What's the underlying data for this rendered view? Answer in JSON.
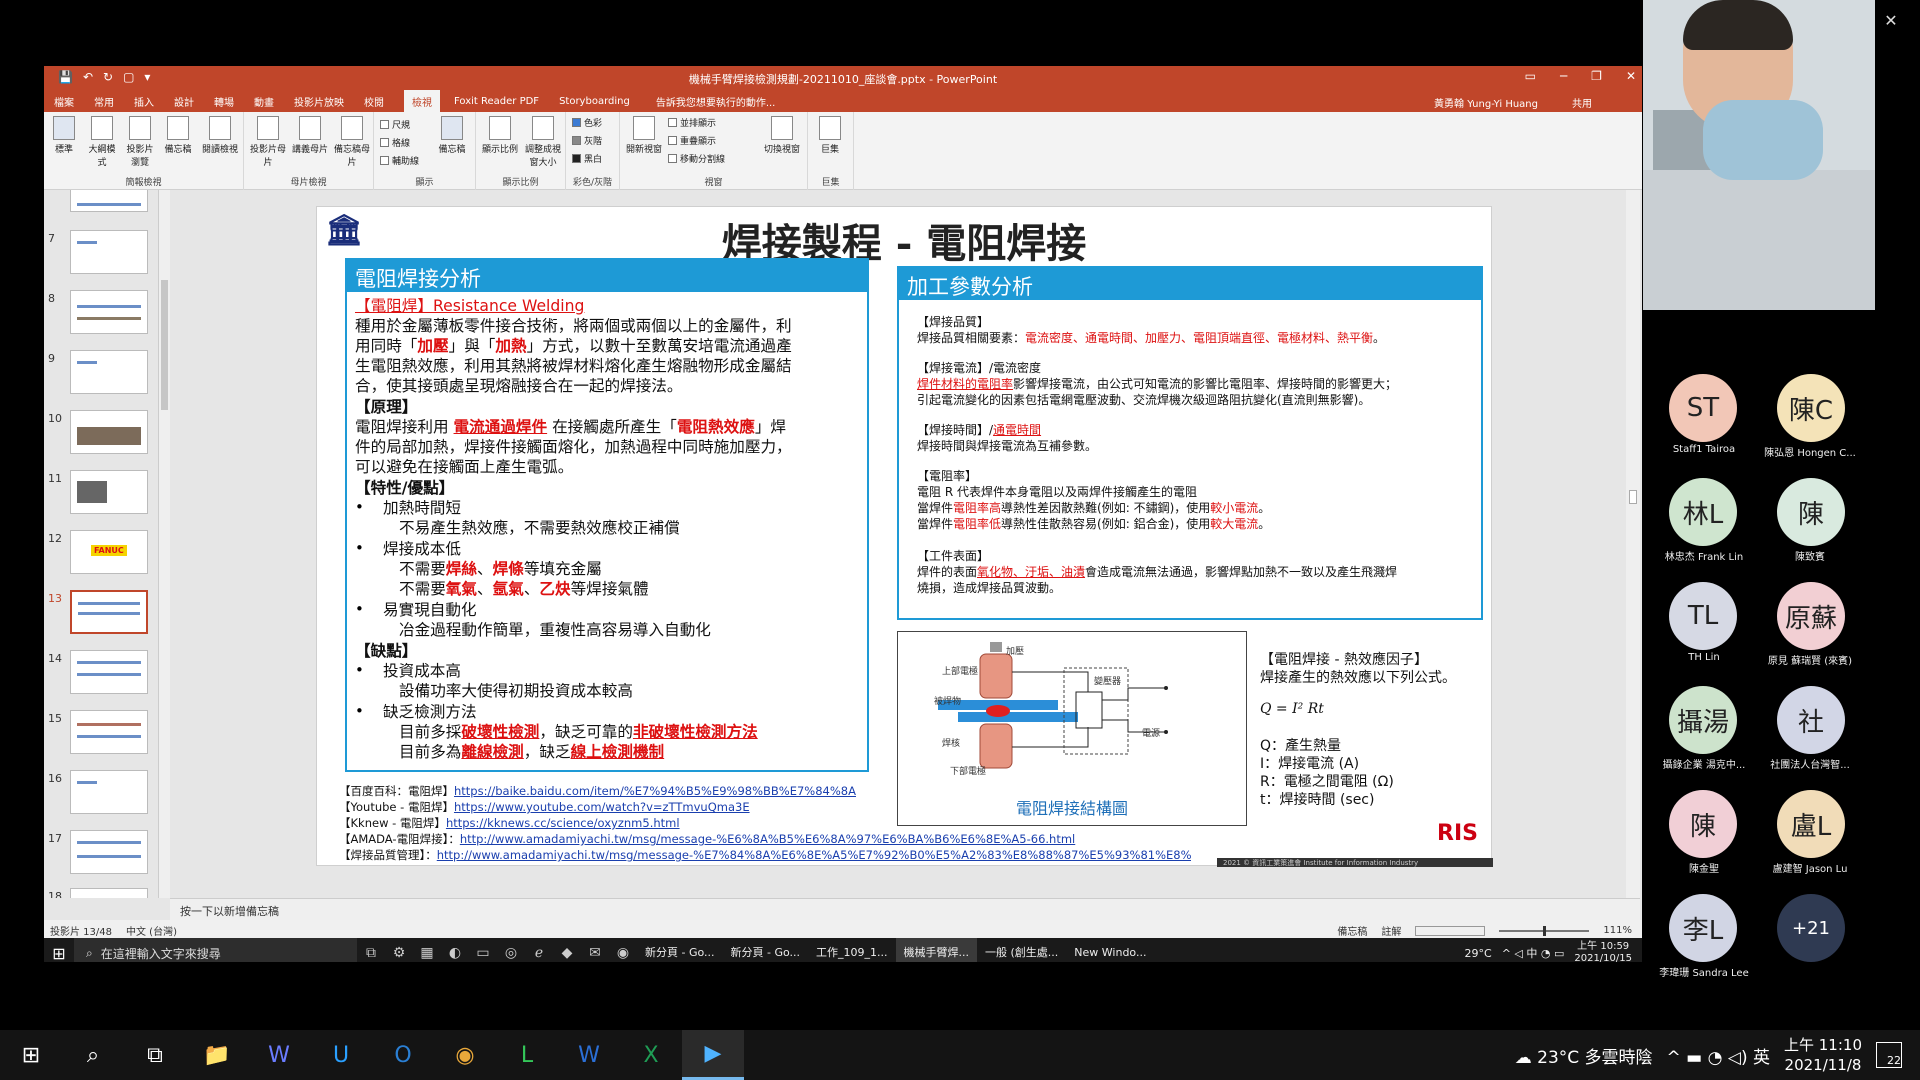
{
  "window": {
    "minimize": "─",
    "restore": "❐",
    "close": "✕"
  },
  "ppt": {
    "title": "機械手臂焊接檢測規劃-20211010_座談會.pptx - PowerPoint",
    "qa": [
      "💾",
      "↶",
      "↻",
      "▢",
      "▾"
    ],
    "win_btns": [
      "▭",
      "─",
      "❐",
      "✕"
    ],
    "tabs": [
      "檔案",
      "常用",
      "插入",
      "設計",
      "轉場",
      "動畫",
      "投影片放映",
      "校閱",
      "檢視",
      "Foxit Reader PDF",
      "Storyboarding"
    ],
    "active_tab": "檢視",
    "tell_me": "告訴我您想要執行的動作...",
    "user": "黃勇翰 Yung-Yi Huang",
    "share": "共用",
    "ribbon": {
      "g1_buttons": [
        "標準",
        "大綱模式",
        "投影片瀏覽",
        "備忘稿",
        "閱讀檢視"
      ],
      "g1_label": "簡報檢視",
      "g2_buttons": [
        "投影片母片",
        "講義母片",
        "備忘稿母片"
      ],
      "g2_label": "母片檢視",
      "g3_checks": [
        "尺規",
        "格線",
        "輔助線"
      ],
      "g3_btn": "備忘稿",
      "g3_label": "顯示",
      "g4_buttons": [
        "顯示比例",
        "調整成視窗大小"
      ],
      "g4_label": "顯示比例",
      "g5_items": [
        "色彩",
        "灰階",
        "黑白"
      ],
      "g5_label": "彩色/灰階",
      "g6_btn": "開新視窗",
      "g6_items": [
        "並排顯示",
        "重疊顯示",
        "移動分割線"
      ],
      "g6_btn2": "切換視窗",
      "g6_label": "視窗",
      "g7_btn": "巨集",
      "g7_label": "巨集"
    },
    "thumb_numbers": [
      "7",
      "8",
      "9",
      "10",
      "11",
      "12",
      "13",
      "14",
      "15",
      "16",
      "17",
      "18"
    ],
    "thumb_fanuc": "FANUC",
    "notes_placeholder": "按一下以新增備忘稿",
    "status": {
      "slide": "投影片 13/48",
      "lang": "中文 (台灣)",
      "notes": "備忘稿",
      "comments": "註解",
      "zoom": "111%"
    }
  },
  "slide": {
    "logo": "🏛",
    "title": "焊接製程 - 電阻焊接",
    "left_header": "電阻焊接分析",
    "l1a": "【電阻焊】Resistance Welding",
    "l2": "種用於金屬薄板零件接合技術，將兩個或兩個以上的金屬件，利",
    "l3a": "用同時「",
    "l3b": "加壓",
    "l3c": "」與「",
    "l3d": "加熱",
    "l3e": "」方式，以數十至數萬安培電流通過產",
    "l4": "生電阻熱效應，利用其熱將被焊材料熔化產生熔融物形成金屬結",
    "l5": "合，使其接頭處呈現熔融接合在一起的焊接法。",
    "l6": "【原理】",
    "l7a": "電阻焊接利用 ",
    "l7b": "電流通過焊件",
    "l7c": " 在接觸處所產生「",
    "l7d": "電阻熱效應",
    "l7e": "」焊",
    "l8": "件的局部加熱，焊接件接觸面熔化，加熱過程中同時施加壓力，",
    "l9": "可以避免在接觸面上產生電弧。",
    "l10": "【特性/優點】",
    "bullet": "•",
    "l11": "加熱時間短",
    "l12": "不易產生熱效應，不需要熱效應校正補償",
    "l13": "焊接成本低",
    "l14a": "不需要",
    "l14b": "焊絲",
    "l14c": "、",
    "l14d": "焊條",
    "l14e": "等填充金屬",
    "l15a": "不需要",
    "l15b": "氧氣",
    "l15c": "、",
    "l15d": "氬氣",
    "l15e": "、",
    "l15f": "乙炔",
    "l15g": "等焊接氣體",
    "l16": "易實現自動化",
    "l17": "冶金過程動作簡單，重複性高容易導入自動化",
    "l18": "【缺點】",
    "l19": "投資成本高",
    "l20": "設備功率大使得初期投資成本較高",
    "l21": "缺乏檢測方法",
    "l22a": "目前多採",
    "l22b": "破壞性檢測",
    "l22c": "，缺乏可靠的",
    "l22d": "非破壞性檢測方法",
    "l23a": "目前多為",
    "l23b": "離線檢測",
    "l23c": "，缺乏",
    "l23d": "線上檢測機制",
    "right_header": "加工參數分析",
    "r1": "【焊接品質】",
    "r2a": "焊接品質相關要素：",
    "r2b": "電流密度、通電時間、加壓力、電阻頂端直徑、電極材料、熱平衡",
    "r2c": "。",
    "r3": "【焊接電流】/電流密度",
    "r4a": "焊件材料的電阻率",
    "r4b": "影響焊接電流，由公式可知電流的影響比電阻率、焊接時間的影響更大；",
    "r5": "引起電流變化的因素包括電網電壓波動、交流焊機次級迴路阻抗變化(直流則無影響)。",
    "r6a": "【焊接時間】/",
    "r6b": "通電時間",
    "r7": "焊接時間與焊接電流為互補參數。",
    "r8": "【電阻率】",
    "r9": "電阻 R 代表焊件本身電阻以及兩焊件接觸產生的電阻",
    "r10a": "當焊件",
    "r10b": "電阻率高",
    "r10c": "導熱性差因散熱難(例如: 不鏽鋼)，使用",
    "r10d": "較小電流",
    "r10e": "。",
    "r11a": "當焊件",
    "r11b": "電阻率低",
    "r11c": "導熱性佳散熱容易(例如: 鋁合金)，使用",
    "r11d": "較大電流",
    "r11e": "。",
    "r12": "【工件表面】",
    "r13a": "焊件的表面",
    "r13b": "氧化物、汙垢、油漬",
    "r13c": "會造成電流無法通過，影響焊點加熱不一致以及產生飛濺焊",
    "r14": "燒損，造成焊接品質波動。",
    "diagram_caption": "電阻焊接結構圖",
    "diagram_labels": {
      "press": "加壓",
      "upper": "上部電極",
      "work": "被焊物",
      "transformer": "變壓器",
      "source": "電源",
      "nugget": "焊核",
      "lower": "下部電極"
    },
    "heat1": "【電阻焊接 - 熱效應因子】",
    "heat2": "焊接產生的熱效應以下列公式。",
    "formula": "Q = I² Rt",
    "v1": "Q：產生熱量",
    "v2": "I：焊接電流 (A)",
    "v3": "R：電極之間電阻 (Ω)",
    "v4": "t：焊接時間 (sec)",
    "ref1a": "【百度百科：電阻焊】",
    "ref1b": "https://baike.baidu.com/item/%E7%94%B5%E9%98%BB%E7%84%8A",
    "ref2a": "【Youtube - 電阻焊】",
    "ref2b": "https://www.youtube.com/watch?v=zTTmvuQma3E",
    "ref3a": "【Kknew - 電阻焊】",
    "ref3b": "https://kknews.cc/science/oxyznm5.html",
    "ref4a": "【AMADA-電阻焊接】：",
    "ref4b": "http://www.amadamiyachi.tw/msg/message-%E6%8A%B5%E6%8A%97%E6%BA%B6%E6%8E%A5-66.html",
    "ref5a": "【焊接品質管理】：",
    "ref5b": "http://www.amadamiyachi.tw/msg/message-%E7%84%8A%E6%8E%A5%E7%92%B0%E5%A2%83%E8%88%87%E5%93%81%E8%B3%AA%E7%AE%A1%E7%90%86-126.html",
    "ris": "RIS",
    "footer": "2021 © 資訊工業策進會 Institute for Information Industry"
  },
  "inner_taskbar": {
    "start": "⊞",
    "search": "在這裡輸入文字來搜尋",
    "icons": [
      "⧉",
      "⚙",
      "▦",
      "◐",
      "▭",
      "◎",
      "ℯ",
      "◆",
      "✉",
      "◉"
    ],
    "apps": [
      "新分頁 - Go...",
      "新分頁 - Go...",
      "工作_109_1...",
      "機械手臂焊...",
      "一般 (創生處...",
      "New Windo..."
    ],
    "temp": "29°C",
    "tray": "^ ◁ 中 ◔ ▭",
    "time": "上午 10:59",
    "date": "2021/10/15"
  },
  "participants": [
    {
      "initials": "ST",
      "name": "Staff1 Tairoa",
      "color": "#f2c7b7"
    },
    {
      "initials": "陳C",
      "name": "陳弘恩 Hongen C...",
      "color": "#f4e3b8"
    },
    {
      "initials": "林L",
      "name": "林忠杰 Frank Lin",
      "color": "#cfe5cf"
    },
    {
      "initials": "陳",
      "name": "陳致賓",
      "color": "#d9eadf"
    },
    {
      "initials": "TL",
      "name": "TH Lin",
      "color": "#d6d9e4"
    },
    {
      "initials": "原蘇",
      "name": "原見 蘇瑞賢 (來賓)",
      "color": "#f2cfd3"
    },
    {
      "initials": "攝湯",
      "name": "攝錄企業 湯克中...",
      "color": "#cde3cc"
    },
    {
      "initials": "社",
      "name": "社團法人台灣智...",
      "color": "#d2d6e6"
    },
    {
      "initials": "陳",
      "name": "陳金聖",
      "color": "#f1cfd6"
    },
    {
      "initials": "盧L",
      "name": "盧建智 Jason Lu",
      "color": "#f1dcb8"
    },
    {
      "initials": "李L",
      "name": "李瑋珊 Sandra Lee",
      "color": "#d1d5e4"
    }
  ],
  "more_participants": "+21",
  "outer_taskbar": {
    "icons": [
      "⊞",
      "⌕",
      "⧉",
      "📁",
      "W",
      "U",
      "O",
      "◉",
      "L",
      "W",
      "X",
      "▶"
    ],
    "weather": "☁ 23°C 多雲時陰",
    "tray": "^  ▬  ◔  ◁)  英",
    "time": "上午 11:10",
    "date": "2021/11/8",
    "notif": "22"
  }
}
